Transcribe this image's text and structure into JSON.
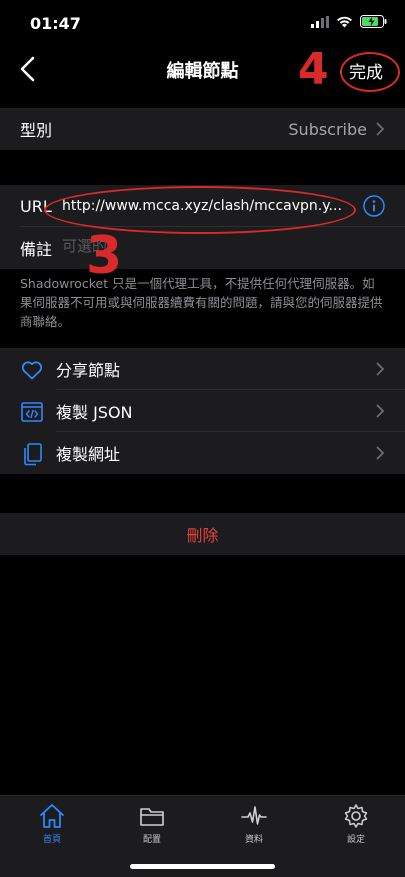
{
  "status_bar": {
    "time": "01:47"
  },
  "nav": {
    "title": "編輯節點",
    "done_label": "完成"
  },
  "type_row": {
    "label": "型別",
    "value": "Subscribe"
  },
  "url_row": {
    "label": "URL",
    "value": "http://www.mcca.xyz/clash/mccavpn.y..."
  },
  "note_row": {
    "label": "備註",
    "placeholder": "可選的"
  },
  "disclaimer": "Shadowrocket 只是一個代理工具，不提供任何代理伺服器。如果伺服器不可用或與伺服器續費有關的問題，請與您的伺服器提供商聯絡。",
  "actions": [
    {
      "label": "分享節點",
      "icon": "heart-icon"
    },
    {
      "label": "複製 JSON",
      "icon": "code-icon"
    },
    {
      "label": "複製網址",
      "icon": "copy-icon"
    }
  ],
  "delete_label": "刪除",
  "annotations": {
    "step_done": "4",
    "step_url": "3",
    "color": "#d82a2a"
  },
  "tabs": [
    {
      "label": "首頁",
      "icon": "home-icon",
      "active": true
    },
    {
      "label": "配置",
      "icon": "folder-icon",
      "active": false
    },
    {
      "label": "資料",
      "icon": "pulse-icon",
      "active": false
    },
    {
      "label": "設定",
      "icon": "gear-icon",
      "active": false
    }
  ],
  "colors": {
    "accent": "#2f87ff",
    "destructive": "#e0433a",
    "cell_bg": "#1c1c1e"
  }
}
